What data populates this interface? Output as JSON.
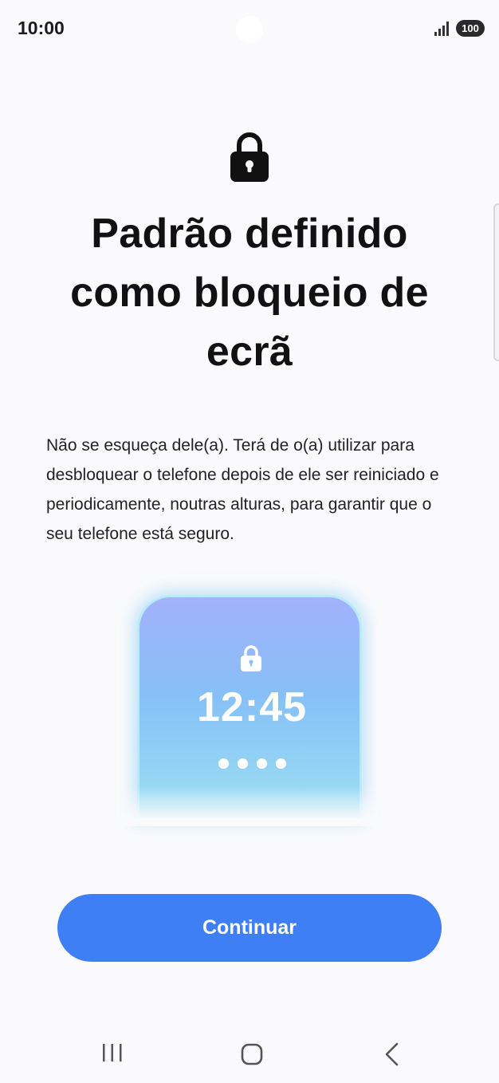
{
  "status_bar": {
    "time": "10:00",
    "battery": "100",
    "icons": [
      "signal-icon",
      "battery-icon"
    ]
  },
  "header": {
    "icon": "lock-icon",
    "title": "Padrão definido como bloqueio de ecrã"
  },
  "description": "Não se esqueça dele(a). Terá de o(a) utilizar para desbloquear o telefone depois de ele ser reiniciado e periodicamente, noutras alturas, para garantir que o seu telefone está seguro.",
  "illustration": {
    "time": "12:45",
    "pin_dots": 4,
    "icon": "lock-icon"
  },
  "actions": {
    "continue_label": "Continuar"
  },
  "navigation": {
    "icons": [
      "recents-icon",
      "home-icon",
      "back-icon"
    ]
  },
  "colors": {
    "accent": "#3f7ff6",
    "background": "#fafafc",
    "illustration_top": "#a3b1fb",
    "illustration_bottom": "#9ee0f2"
  }
}
